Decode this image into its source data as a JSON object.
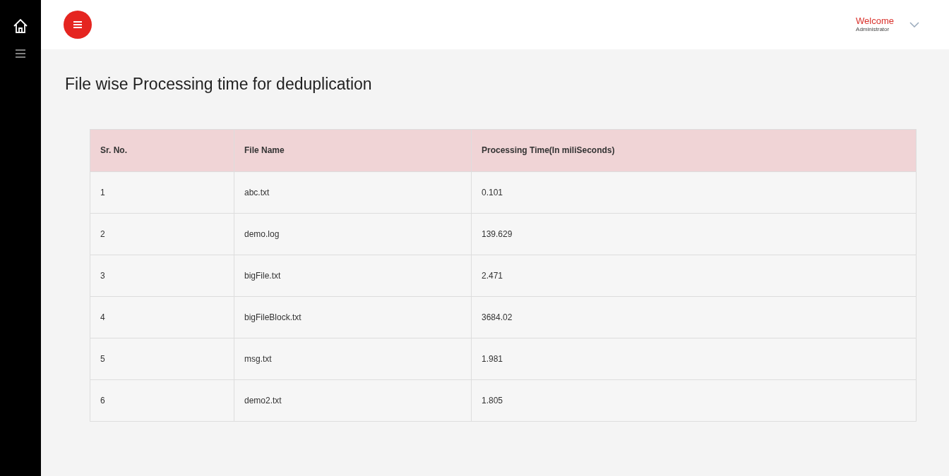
{
  "header": {
    "welcome": "Welcome",
    "user": "Administrator"
  },
  "title": "File wise Processing time for deduplication",
  "table": {
    "columns": [
      "Sr. No.",
      "File Name",
      "Processing Time(In miliSeconds)"
    ],
    "rows": [
      [
        "1",
        "abc.txt",
        "0.101"
      ],
      [
        "2",
        "demo.log",
        "139.629"
      ],
      [
        "3",
        "bigFile.txt",
        "2.471"
      ],
      [
        "4",
        "bigFileBlock.txt",
        "3684.02"
      ],
      [
        "5",
        "msg.txt",
        "1.981"
      ],
      [
        "6",
        "demo2.txt",
        "1.805"
      ]
    ]
  }
}
